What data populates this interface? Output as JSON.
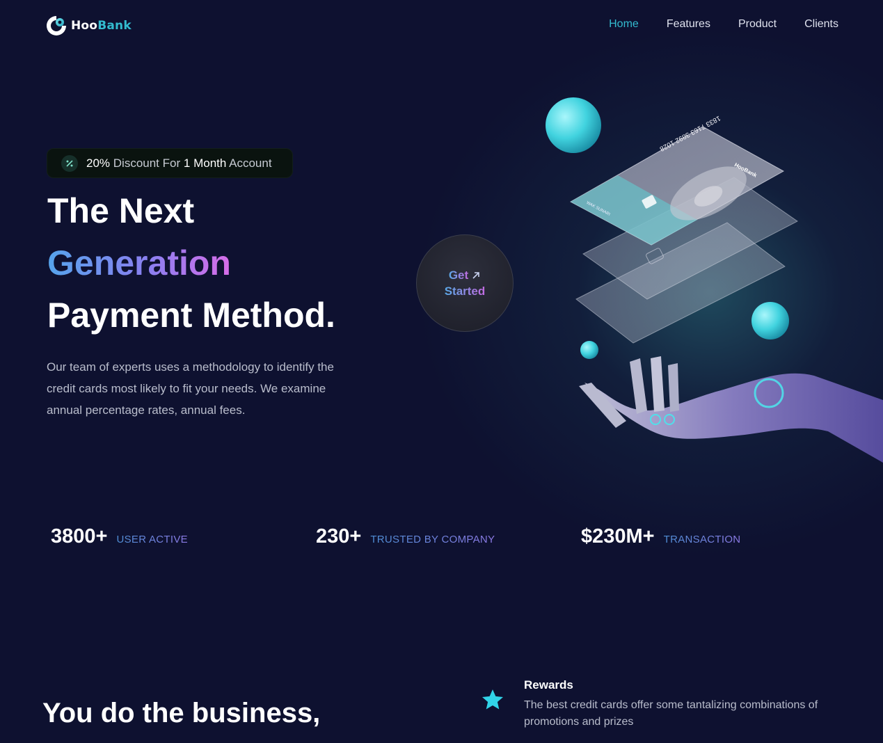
{
  "brand": {
    "name_part1": "Hoo",
    "name_part2": "Bank",
    "accent": "#33bbcf"
  },
  "nav": {
    "items": [
      {
        "label": "Home",
        "active": true
      },
      {
        "label": "Features",
        "active": false
      },
      {
        "label": "Product",
        "active": false
      },
      {
        "label": "Clients",
        "active": false
      }
    ]
  },
  "hero": {
    "discount": {
      "icon": "percent-icon",
      "strong1": "20%",
      "dim1": "Discount For",
      "strong2": "1",
      "dim2": "Month",
      "dim3": "Account"
    },
    "title_line1": "The Next",
    "title_line2": "Generation",
    "title_line3": "Payment Method.",
    "description": "Our team of experts uses a methodology to identify the credit cards most likely to fit your needs. We examine annual percentage rates, annual fees.",
    "cta": {
      "line1": "Get",
      "line2": "Started",
      "icon": "arrow-up-right-icon"
    },
    "card": {
      "number": "1833 7163 3892 1028",
      "holder": "WAK SUNARI",
      "brand": "HooBank"
    }
  },
  "stats": [
    {
      "value": "3800+",
      "label": "USER ACTIVE"
    },
    {
      "value": "230+",
      "label": "TRUSTED BY COMPANY"
    },
    {
      "value": "$230M+",
      "label": "TRANSACTION"
    }
  ],
  "business": {
    "heading": "You do the business,",
    "feature": {
      "icon": "star-icon",
      "title": "Rewards",
      "text": "The best credit cards offer some tantalizing combinations of promotions and prizes"
    }
  }
}
